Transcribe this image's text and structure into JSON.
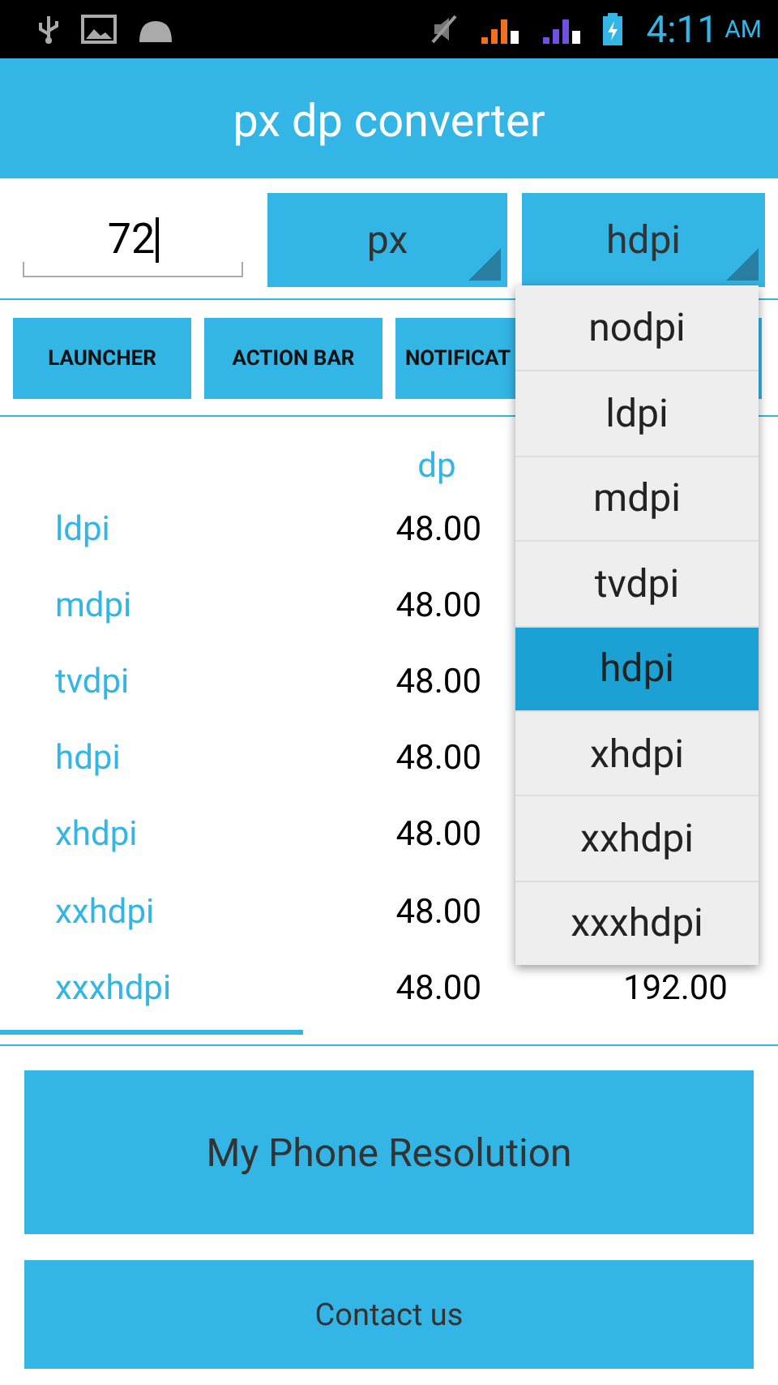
{
  "status_bar": {
    "time": "4:11",
    "ampm": "AM"
  },
  "title": "px dp converter",
  "input": {
    "value": "72"
  },
  "spinners": [
    {
      "value": "px"
    },
    {
      "value": "hdpi"
    }
  ],
  "tabs": [
    {
      "label": "LAUNCHER"
    },
    {
      "label": "ACTION BAR"
    },
    {
      "label": "NOTIFICAT"
    }
  ],
  "table": {
    "columns": [
      "dp"
    ],
    "rows": [
      {
        "name": "ldpi",
        "dp": "48.00"
      },
      {
        "name": "mdpi",
        "dp": "48.00"
      },
      {
        "name": "tvdpi",
        "dp": "48.00"
      },
      {
        "name": "hdpi",
        "dp": "48.00"
      },
      {
        "name": "xhdpi",
        "dp": "48.00"
      },
      {
        "name": "xxhdpi",
        "dp": "48.00"
      },
      {
        "name": "xxxhdpi",
        "dp": "48.00",
        "column_3": "192.00"
      }
    ]
  },
  "buttons": [
    "My Phone Resolution",
    "Contact us"
  ],
  "dropdown": [
    {
      "label": "nodpi",
      "selected": false
    },
    {
      "label": "ldpi",
      "selected": false
    },
    {
      "label": "mdpi",
      "selected": false
    },
    {
      "label": "tvdpi",
      "selected": false
    },
    {
      "label": "hdpi",
      "selected": true
    },
    {
      "label": "xhdpi",
      "selected": false
    },
    {
      "label": "xxhdpi",
      "selected": false
    },
    {
      "label": "xxxhdpi",
      "selected": false
    }
  ]
}
